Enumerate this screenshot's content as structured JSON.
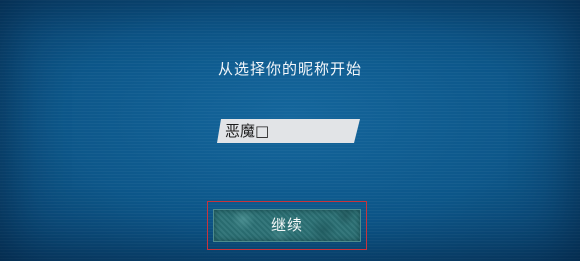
{
  "dialog": {
    "prompt": "从选择你的昵称开始"
  },
  "nickname_input": {
    "value": "恶魔□"
  },
  "continue_button": {
    "label": "继续"
  },
  "colors": {
    "background": "#0c5486",
    "input_background": "#e2e4e7",
    "button_background": "#2b7175",
    "highlight_frame": "#c8343c"
  }
}
